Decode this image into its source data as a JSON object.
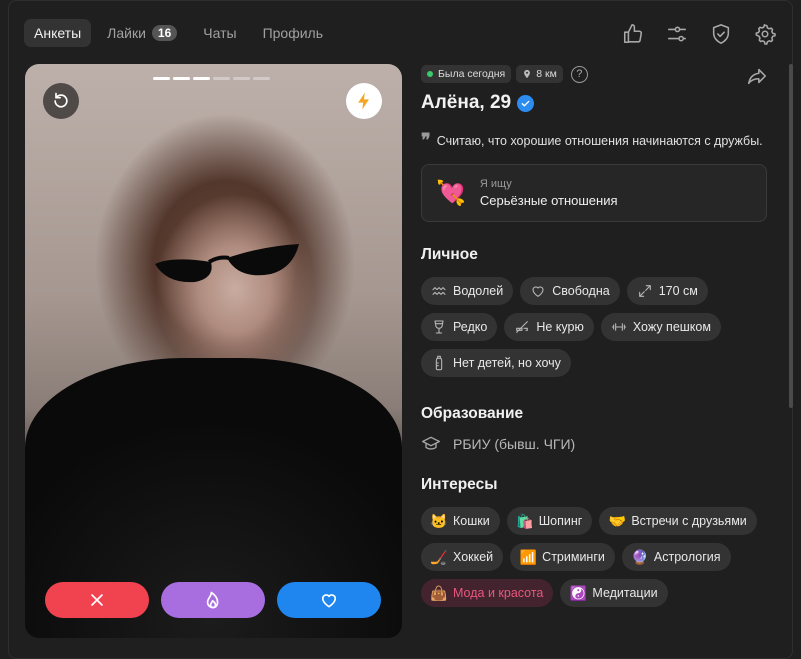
{
  "nav": {
    "tabs": [
      {
        "label": "Анкеты"
      },
      {
        "label": "Лайки",
        "badge": "16"
      },
      {
        "label": "Чаты"
      },
      {
        "label": "Профиль"
      }
    ],
    "icons": [
      "thumbs-up-icon",
      "sliders-icon",
      "shield-check-icon",
      "gear-icon"
    ]
  },
  "photo": {
    "total_photos": 6,
    "current_photo": 3
  },
  "profile": {
    "status": "Была сегодня",
    "distance": "8 км",
    "help": "?",
    "name": "Алёна, 29",
    "bio": "Считаю, что хорошие отношения начинаются с дружбы.",
    "looking_label": "Я ищу",
    "looking_value": "Серьёзные отношения"
  },
  "sections": {
    "personal": "Личное",
    "education": "Образование",
    "interests": "Интересы"
  },
  "personal": [
    {
      "icon": "aquarius-icon",
      "label": "Водолей"
    },
    {
      "icon": "heart-outline-icon",
      "label": "Свободна"
    },
    {
      "icon": "height-arrows-icon",
      "label": "170 см"
    },
    {
      "icon": "wine-glass-icon",
      "label": "Редко"
    },
    {
      "icon": "no-smoking-icon",
      "label": "Не курю"
    },
    {
      "icon": "dumbbell-icon",
      "label": "Хожу пешком"
    },
    {
      "icon": "baby-bottle-icon",
      "label": "Нет детей, но хочу"
    }
  ],
  "education": "РБИУ (бывш. ЧГИ)",
  "interests": [
    {
      "emoji": "🐱",
      "label": "Кошки"
    },
    {
      "emoji": "🛍️",
      "label": "Шопинг"
    },
    {
      "emoji": "🤝",
      "label": "Встречи с друзьями"
    },
    {
      "emoji": "🏒",
      "label": "Хоккей"
    },
    {
      "emoji": "📶",
      "label": "Стриминги"
    },
    {
      "emoji": "🔮",
      "label": "Астрология"
    },
    {
      "emoji": "👜",
      "label": "Мода и красота",
      "highlight": true
    },
    {
      "emoji": "☯️",
      "label": "Медитации"
    }
  ],
  "colors": {
    "dislike": "#f0434f",
    "superlike": "#a86ee0",
    "like": "#1f86f0",
    "online": "#3cc96b",
    "verified": "#2c8cf0",
    "highlight": "#e9577f"
  }
}
